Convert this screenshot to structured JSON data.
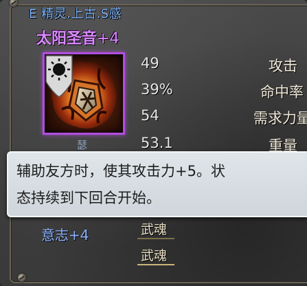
{
  "item": {
    "subtitle": "E 精灵.上古.S感",
    "name": "太阳圣音",
    "enhance": "+4",
    "icon": "sun-shield-flame-icon"
  },
  "stats": [
    {
      "value": "49",
      "label": "攻击"
    },
    {
      "value": "39%",
      "label": "命中率"
    },
    {
      "value": "54",
      "label": "需求力量"
    },
    {
      "value": "53.1",
      "label": "重量"
    }
  ],
  "tooltip": {
    "line1": "辅助友方时，使其攻击力+5。状",
    "line2": "态持续到下回合开始。"
  },
  "peek_char": "瑟",
  "attributes": [
    {
      "label": "意志+4"
    }
  ],
  "soul_slots": [
    {
      "label": "武魂"
    },
    {
      "label": "武魂"
    }
  ],
  "colors": {
    "subtitle": "#7fb6ff",
    "item_name": "#d98bff",
    "icon_border": "#b14ee0",
    "attribute": "#8fb2ff",
    "tooltip_bg": "#dfe5e9"
  }
}
